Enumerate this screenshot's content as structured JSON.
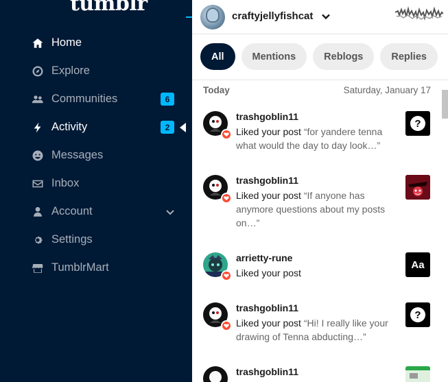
{
  "app": {
    "logo": "tumblr"
  },
  "sidebar": {
    "items": [
      {
        "label": "Home",
        "icon": "home-icon",
        "active": true
      },
      {
        "label": "Explore",
        "icon": "compass-icon"
      },
      {
        "label": "Communities",
        "icon": "people-icon",
        "badge": "6"
      },
      {
        "label": "Activity",
        "icon": "lightning-icon",
        "badge": "2",
        "current": true
      },
      {
        "label": "Messages",
        "icon": "smiley-icon"
      },
      {
        "label": "Inbox",
        "icon": "envelope-icon"
      },
      {
        "label": "Account",
        "icon": "person-icon",
        "expandable": true
      },
      {
        "label": "Settings",
        "icon": "gear-icon"
      },
      {
        "label": "TumblrMart",
        "icon": "store-icon"
      }
    ]
  },
  "activity": {
    "blog_name": "craftyjellyfishcat",
    "filters": [
      "All",
      "Mentions",
      "Reblogs",
      "Replies"
    ],
    "active_filter": "All",
    "day_label": "Today",
    "date_label": "Saturday, January 17",
    "notifications": [
      {
        "user": "trashgoblin11",
        "action": "Liked your post",
        "quote": "“for yandere tenna what would the day to day look…”",
        "thumb": "question-icon"
      },
      {
        "user": "trashgoblin11",
        "action": "Liked your post",
        "quote": "“If anyone has anymore questions about my posts on…”",
        "thumb": "image"
      },
      {
        "user": "arrietty-rune",
        "action": "Liked your post",
        "quote": "",
        "thumb": "text-aa-icon",
        "thumb_text": "Aa"
      },
      {
        "user": "trashgoblin11",
        "action": "Liked your post",
        "quote": "“Hi! I really like your drawing of Tenna abducting…”",
        "thumb": "question-icon"
      },
      {
        "user": "trashgoblin11",
        "action": "",
        "quote": "",
        "thumb": "image"
      }
    ]
  },
  "colors": {
    "navy": "#001935",
    "accent_blue": "#00b8ff",
    "like_red": "#ff4930"
  }
}
